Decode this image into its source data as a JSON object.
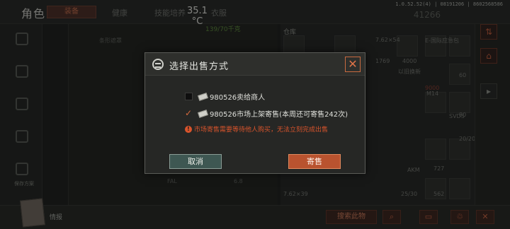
{
  "header": {
    "title": "角色",
    "tabs": [
      "装备",
      "健康",
      "技能培养",
      "衣服"
    ],
    "temperature": "35.1",
    "temperature_unit": "°C",
    "version": "1.0.52.52(4) | 08191206 | 8602568586",
    "money": "41266"
  },
  "background": {
    "green_text": "139/70千克",
    "store_title": "仓库",
    "labels": [
      "条形遮罩",
      "FAL",
      "6.8",
      "7.62×39",
      "7.62×54",
      "M14",
      "SVDS",
      "AKM",
      "20/20",
      "25/30",
      "727",
      "562",
      "80",
      "60",
      "1769",
      "4000",
      "E-国际应急包",
      "以旧换新",
      "9000"
    ],
    "leftrail_label": "保存方案"
  },
  "dialog": {
    "title": "选择出售方式",
    "option1": "980526卖给商人",
    "option2": "980526市场上架寄售(本周还可寄售242次)",
    "warning": "市场寄售需要等待他人购买，无法立刻完成出售",
    "cancel_label": "取消",
    "sell_label": "寄售",
    "close_icon": "close-icon"
  },
  "bottombar": {
    "label": "情报",
    "search_label": "搜索此物"
  },
  "colors": {
    "accent": "#b9532f",
    "cancel": "#3e5752",
    "warning": "#d9542c"
  }
}
